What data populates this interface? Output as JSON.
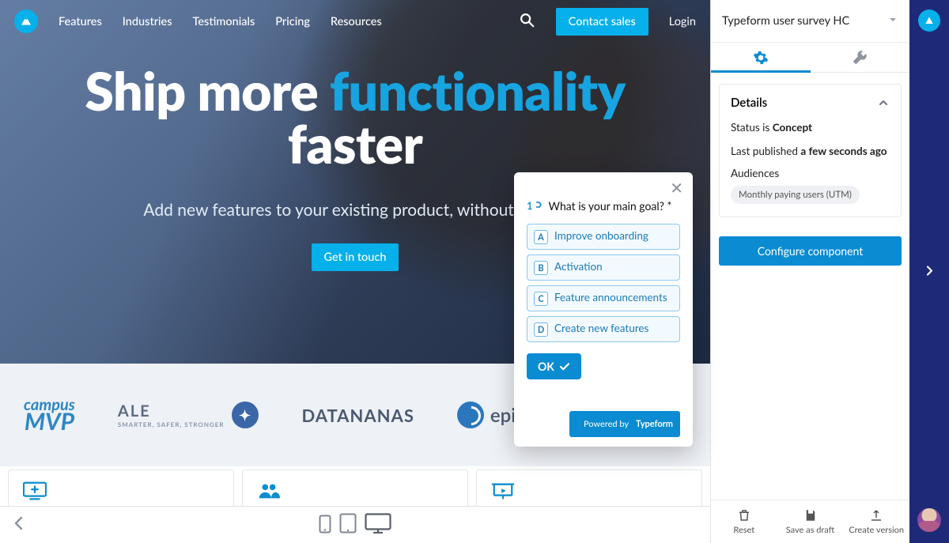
{
  "nav": {
    "items": [
      "Features",
      "Industries",
      "Testimonials",
      "Pricing",
      "Resources"
    ],
    "contact": "Contact sales",
    "login": "Login"
  },
  "hero": {
    "h1_a": "Ship more ",
    "h1_b": "functionality",
    "h1_c": "faster",
    "sub": "Add new features to your existing product, without distrac",
    "cta": "Get in touch"
  },
  "clients": {
    "campus_a": "campus",
    "campus_b": "MVP",
    "ale": "ALE",
    "ale_sub": "SMARTER, SAFER, STRONGER",
    "datananas": "DATANANAS",
    "epiphan": "epiphan"
  },
  "survey": {
    "qnum": "1",
    "question": "What is your main goal? *",
    "options": [
      {
        "key": "A",
        "label": "Improve onboarding"
      },
      {
        "key": "B",
        "label": "Activation"
      },
      {
        "key": "C",
        "label": "Feature announcements"
      },
      {
        "key": "D",
        "label": "Create new features"
      }
    ],
    "ok": "OK",
    "powered_a": "Powered by ",
    "powered_b": "Typeform"
  },
  "panel": {
    "title": "Typeform user survey HC",
    "details_heading": "Details",
    "status_label": "Status is ",
    "status_value": "Concept",
    "published_label": "Last published ",
    "published_value": "a few seconds ago",
    "audiences_label": "Audiences",
    "audience_chip": "Monthly paying users (UTM)",
    "configure": "Configure component",
    "actions": {
      "reset": "Reset",
      "save": "Save as draft",
      "create": "Create version"
    }
  }
}
